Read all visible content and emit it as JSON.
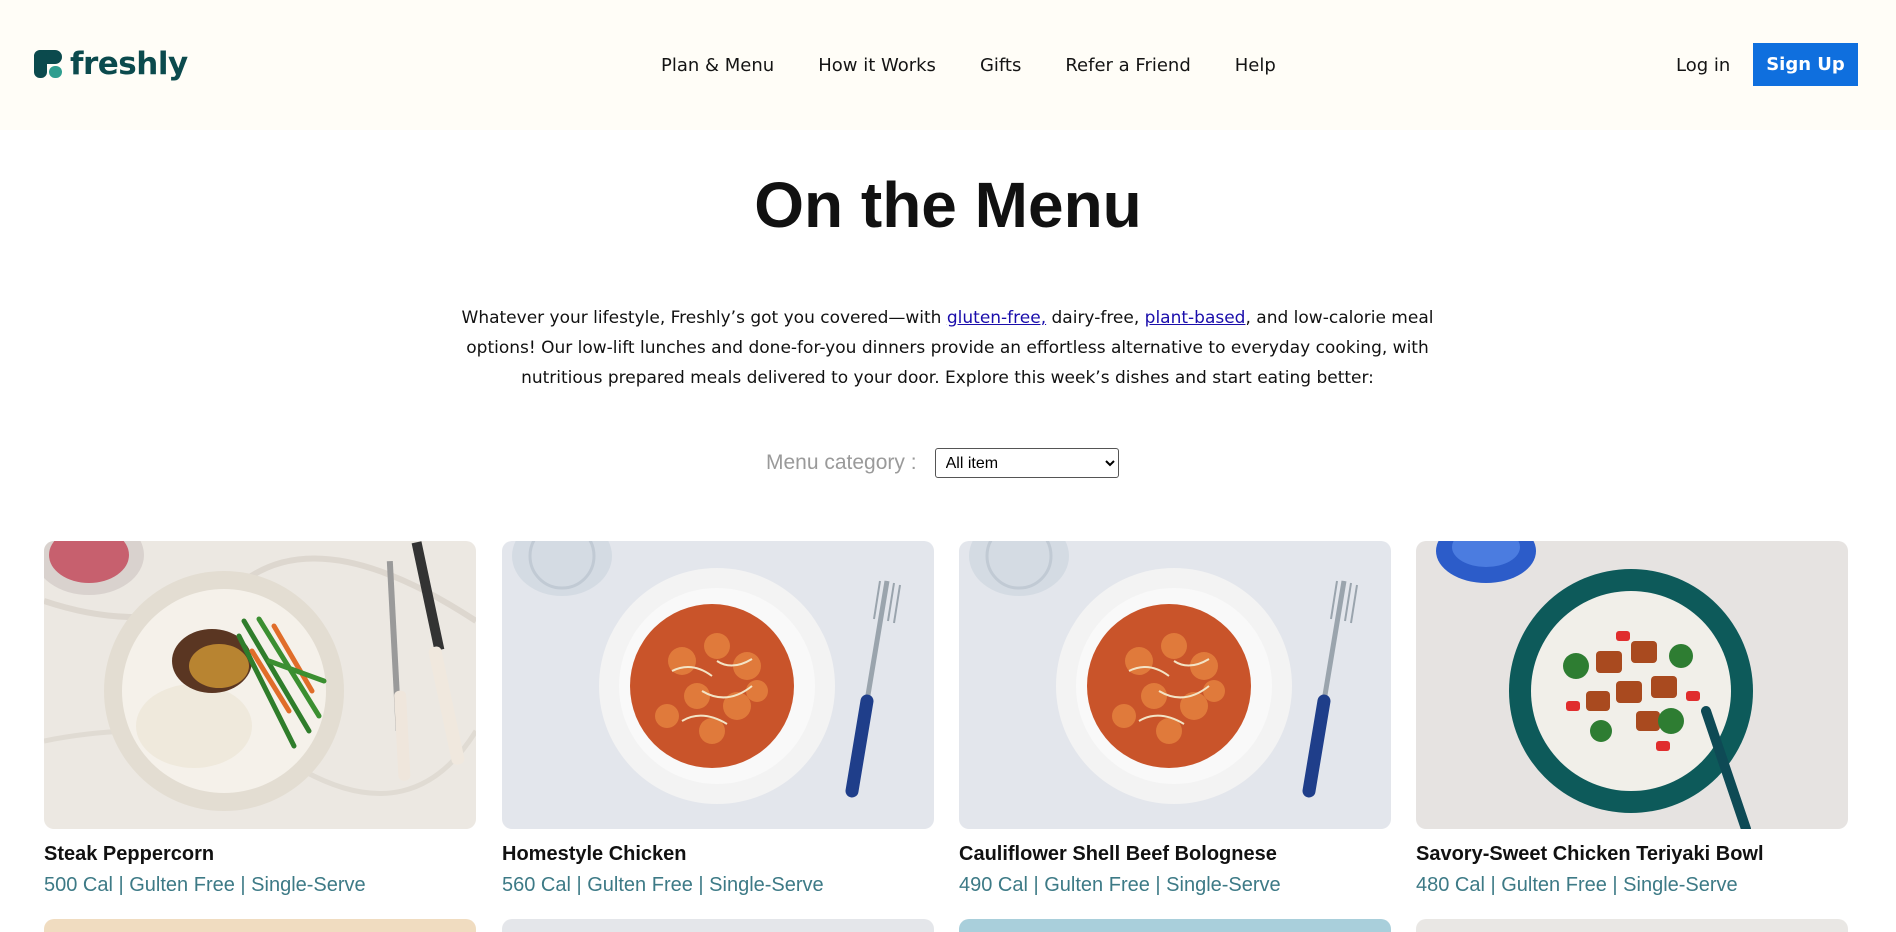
{
  "header": {
    "logo_text": "freshly",
    "nav": [
      "Plan & Menu",
      "How it Works",
      "Gifts",
      "Refer a Friend",
      "Help"
    ],
    "login_label": "Log in",
    "signup_label": "Sign Up"
  },
  "hero": {
    "title": "On the Menu",
    "intro": {
      "part1": "Whatever your lifestyle, Freshly’s got you covered—with ",
      "link1": "gluten-free,",
      "part2": " dairy-free, ",
      "link2": "plant-based",
      "part3": ", and low-calorie meal options! Our low-lift lunches and done-for-you dinners provide an effortless alternative to everyday cooking, with nutritious prepared meals delivered to your door. Explore this week’s dishes and start eating better:"
    }
  },
  "filter": {
    "label": "Menu category :",
    "selected": "All item"
  },
  "meals": [
    {
      "name": "Steak Peppercorn",
      "meta": "500 Cal | Gulten Free | Single-Serve",
      "image": "steak-plate-image"
    },
    {
      "name": "Homestyle Chicken",
      "meta": "560 Cal | Gulten Free | Single-Serve",
      "image": "pasta-bowl-image"
    },
    {
      "name": "Cauliflower Shell Beef Bolognese",
      "meta": "490 Cal | Gulten Free | Single-Serve",
      "image": "pasta-bowl-image"
    },
    {
      "name": "Savory-Sweet Chicken Teriyaki Bowl",
      "meta": "480 Cal | Gulten Free | Single-Serve",
      "image": "teriyaki-bowl-image"
    }
  ],
  "colors": {
    "brand": "#0b4a4d",
    "accent": "#0f6fde",
    "meta_text": "#3d7a86",
    "header_bg": "#fffdf7"
  }
}
